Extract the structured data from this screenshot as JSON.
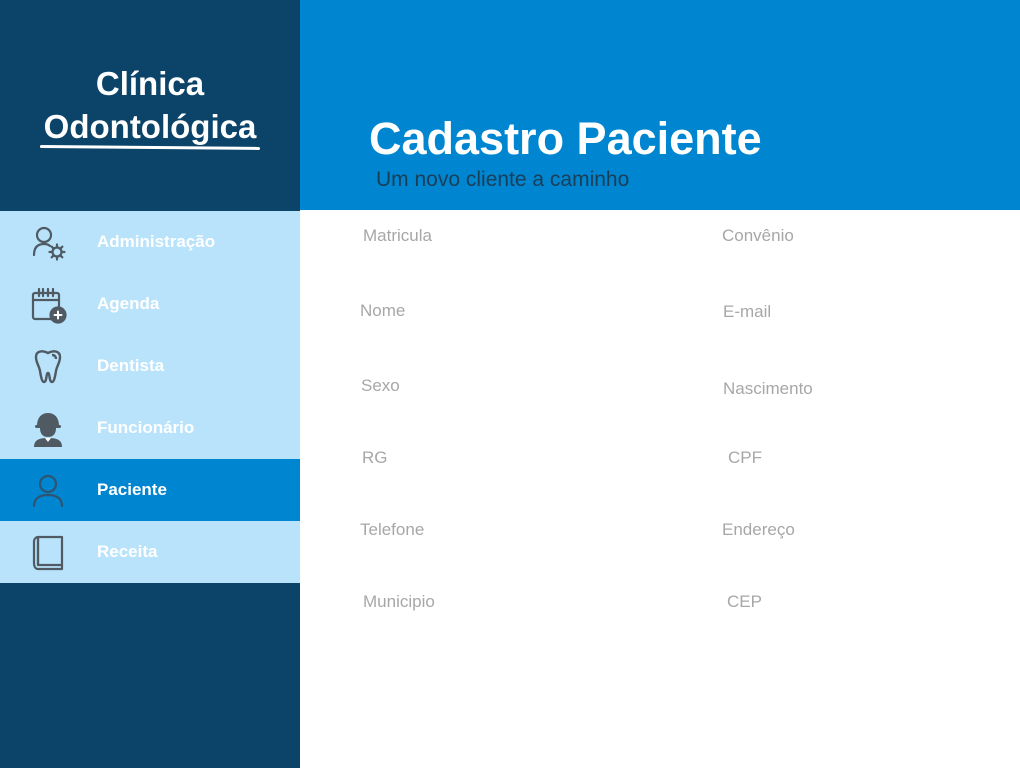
{
  "brand": {
    "line1": "Clínica",
    "line2": "Odontológica"
  },
  "header": {
    "title": "Cadastro Paciente",
    "subtitle": "Um novo cliente a caminho"
  },
  "sidebar": {
    "items": [
      {
        "label": "Administração",
        "icon": "admin-user-gear-icon",
        "active": false
      },
      {
        "label": "Agenda",
        "icon": "calendar-add-icon",
        "active": false
      },
      {
        "label": "Dentista",
        "icon": "tooth-icon",
        "active": false
      },
      {
        "label": "Funcionário",
        "icon": "employee-icon",
        "active": false
      },
      {
        "label": "Paciente",
        "icon": "user-icon",
        "active": true
      },
      {
        "label": "Receita",
        "icon": "book-icon",
        "active": false
      }
    ]
  },
  "form": {
    "matricula": {
      "placeholder": "Matricula",
      "value": ""
    },
    "convenio": {
      "placeholder": "Convênio",
      "value": ""
    },
    "nome": {
      "placeholder": "Nome",
      "value": ""
    },
    "email": {
      "placeholder": "E-mail",
      "value": ""
    },
    "sexo": {
      "placeholder": "Sexo",
      "value": ""
    },
    "nascimento": {
      "placeholder": "Nascimento",
      "value": ""
    },
    "rg": {
      "placeholder": "RG",
      "value": ""
    },
    "cpf": {
      "placeholder": "CPF",
      "value": ""
    },
    "telefone": {
      "placeholder": "Telefone",
      "value": ""
    },
    "endereco": {
      "placeholder": "Endereço",
      "value": ""
    },
    "municipio": {
      "placeholder": "Municipio",
      "value": ""
    },
    "cep": {
      "placeholder": "CEP",
      "value": ""
    }
  },
  "colors": {
    "sidebar_dark": "#0b4468",
    "menu_light": "#b8e3fb",
    "accent": "#0086d1",
    "icon_gray": "#4f5a63",
    "placeholder": "#a7a7a7"
  }
}
